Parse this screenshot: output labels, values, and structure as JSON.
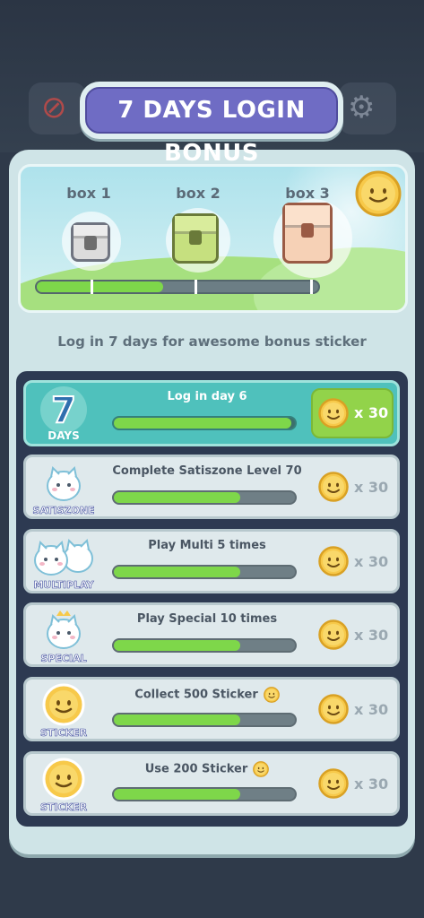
{
  "title": "7 DAYS LOGIN BONUS",
  "boxes": [
    {
      "label": "box 1",
      "color": "#dcdcdc"
    },
    {
      "label": "box 2",
      "color": "#c6e07f"
    },
    {
      "label": "box 3",
      "color": "#f6d1b6"
    }
  ],
  "overall_progress": 0.45,
  "subtitle": "Log in 7 days for awesome bonus sticker",
  "tasks": [
    {
      "icon_label": "DAYS",
      "icon_name": "seven-days-icon",
      "text": "Log in day 6",
      "progress": 0.98,
      "reward": "x 30",
      "active": true
    },
    {
      "icon_label": "SATISZONE",
      "icon_name": "satiszone-cat-icon",
      "text": "Complete Satiszone Level 70",
      "progress": 0.7,
      "reward": "x 30"
    },
    {
      "icon_label": "MULTIPLAY",
      "icon_name": "multiplay-cats-icon",
      "text": "Play Multi 5 times",
      "progress": 0.7,
      "reward": "x 30"
    },
    {
      "icon_label": "SPECIAL",
      "icon_name": "special-crown-cat-icon",
      "text": "Play Special 10 times",
      "progress": 0.7,
      "reward": "x 30"
    },
    {
      "icon_label": "STICKER",
      "icon_name": "sticker-coin-icon",
      "text": "Collect 500 Sticker",
      "progress": 0.7,
      "reward": "x 30"
    },
    {
      "icon_label": "STICKER",
      "icon_name": "sticker-coin-icon",
      "text": "Use 200 Sticker",
      "progress": 0.7,
      "reward": "x 30"
    }
  ]
}
